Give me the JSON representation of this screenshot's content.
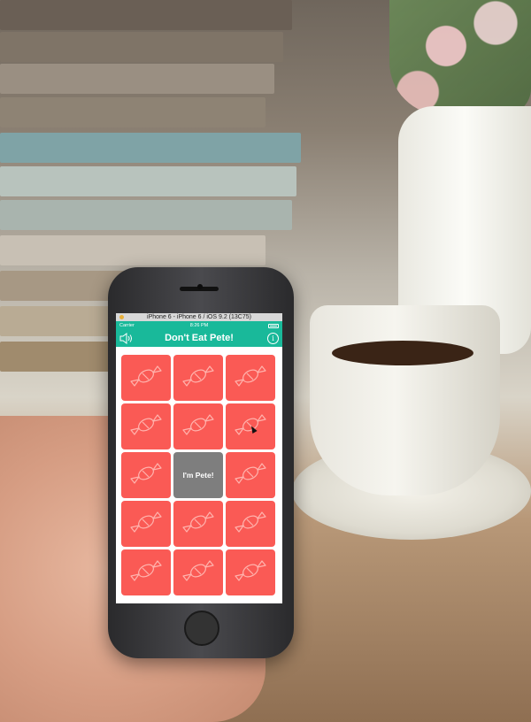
{
  "simulator": {
    "title": "iPhone 6 - iPhone 6 / iOS 9.2 (13C75)"
  },
  "status_bar": {
    "carrier": "Carrier",
    "time": "8:26 PM"
  },
  "navbar": {
    "title": "Don't Eat Pete!",
    "sound_icon": "speaker-icon",
    "info_icon": "info-icon",
    "info_glyph": "i"
  },
  "board": {
    "rows": 5,
    "columns": 3,
    "tile_color": "#fa5a55",
    "pete_color": "#7e7e7e",
    "tile_icon": "candy-icon",
    "pete_label": "I'm Pete!",
    "pete_row": 3,
    "pete_column": 2
  },
  "colors": {
    "navbar": "#19b99a"
  }
}
